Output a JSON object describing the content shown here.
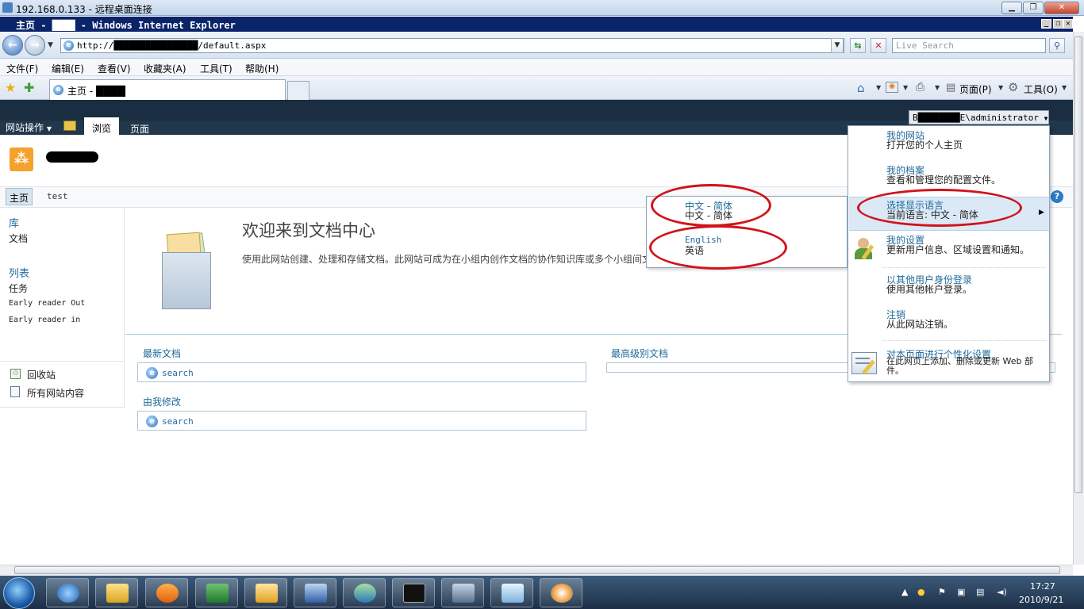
{
  "rdp": {
    "title": "192.168.0.133 - 远程桌面连接",
    "min": "▁",
    "restore": "❐",
    "close": "✕"
  },
  "ie": {
    "window_title": "主页 - ████ - Windows Internet Explorer",
    "url": "http://████████████████/default.aspx",
    "search_placeholder": "Live Search",
    "menus": [
      "文件(F)",
      "编辑(E)",
      "查看(V)",
      "收藏夹(A)",
      "工具(T)",
      "帮助(H)"
    ],
    "tab_label": "主页 - ████",
    "cmd_page": "页面(P)",
    "cmd_tools": "工具(O)"
  },
  "sharepoint": {
    "user_label": "B████████E\\administrator",
    "site_actions": "网站操作",
    "tab_browse": "浏览",
    "tab_page": "页面",
    "site_title": "████",
    "nav": {
      "home": "主页",
      "test": "test"
    },
    "quicklaunch": {
      "libraries_head": "库",
      "documents": "文档",
      "lists_head": "列表",
      "tasks": "任务",
      "early_out": "Early reader Out",
      "early_in": "Early reader in",
      "recycle": "回收站",
      "all_content": "所有网站内容"
    },
    "welcome_title": "欢迎来到文档中心",
    "welcome_desc": "使用此网站创建、处理和存储文档。此网站可成为在小组内创作文档的协作知识库或多个小组间文",
    "webparts": {
      "newest": "最新文档",
      "modified_by_me": "由我修改",
      "highest_rated": "最高级别文档",
      "search1": "search",
      "search2": "search"
    },
    "user_menu": [
      {
        "title": "我的网站",
        "desc": "打开您的个人主页"
      },
      {
        "title": "我的档案",
        "desc": "查看和管理您的配置文件。"
      },
      {
        "title": "选择显示语言",
        "desc": "当前语言: 中文 - 简体"
      },
      {
        "title": "我的设置",
        "desc": "更新用户信息、区域设置和通知。"
      },
      {
        "title": "以其他用户身份登录",
        "desc": "使用其他帐户登录。"
      },
      {
        "title": "注销",
        "desc": "从此网站注销。"
      },
      {
        "title": "对本页面进行个性化设置",
        "desc": "在此网页上添加、删除或更新 Web 部件。"
      }
    ],
    "language_menu": [
      {
        "title": "中文 - 简体",
        "desc": "中文 - 简体"
      },
      {
        "title": "English",
        "desc": "英语"
      }
    ]
  },
  "taskbar": {
    "time": "17:27",
    "date": "2010/9/21"
  },
  "colors": {
    "accent": "#1f6a9a",
    "header": "#21374c",
    "highlight_circle": "#d0141b"
  }
}
